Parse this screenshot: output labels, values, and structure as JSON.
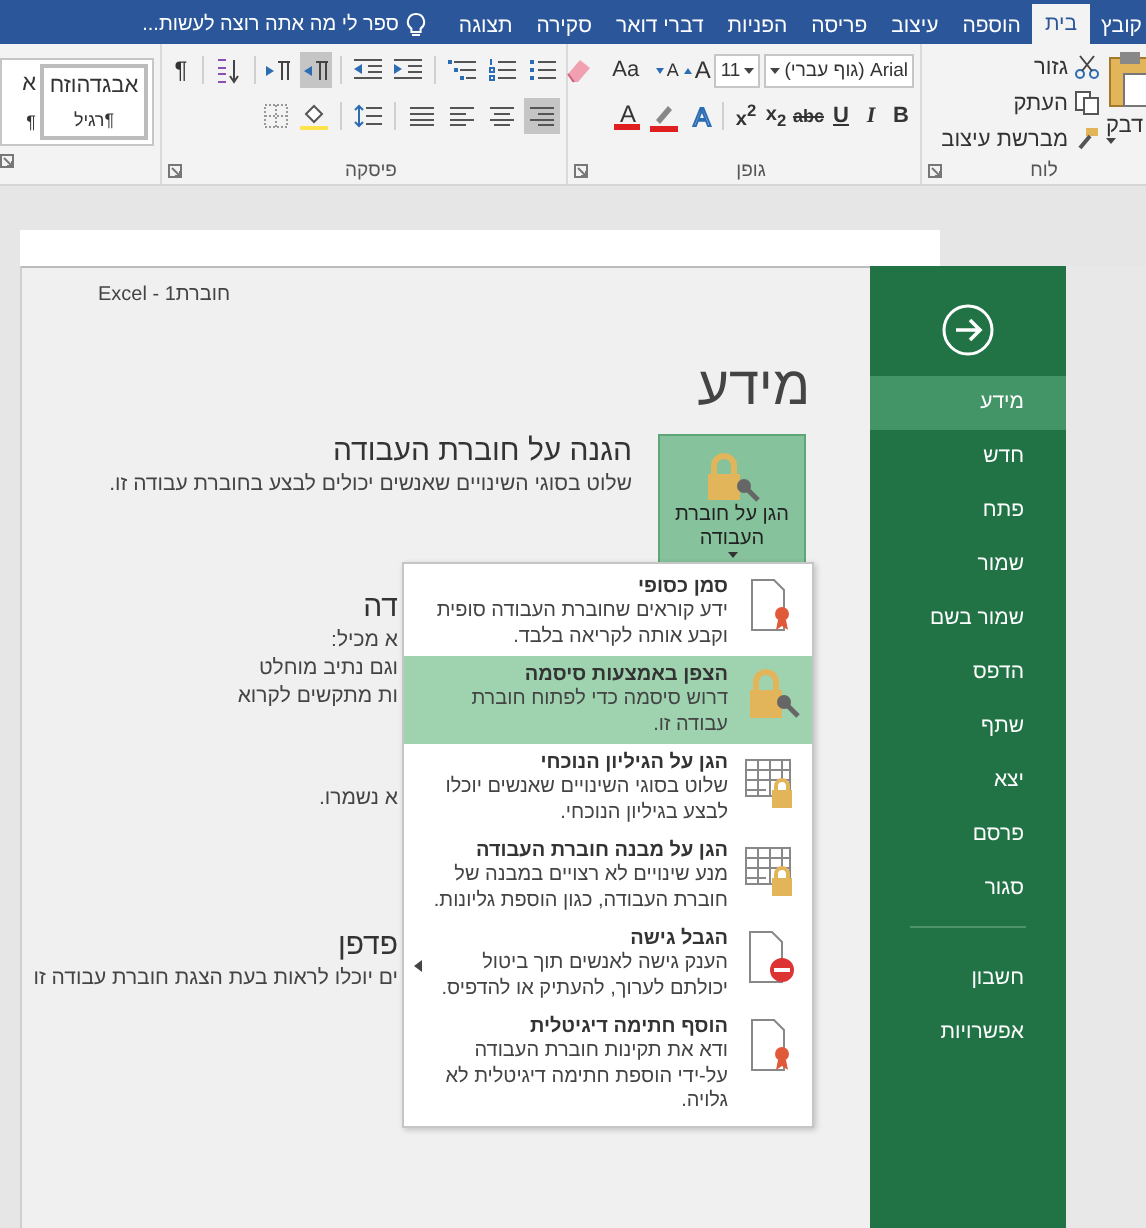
{
  "ribbon_tabs": {
    "tabs": [
      {
        "label": "קובץ",
        "selected": false
      },
      {
        "label": "בית",
        "selected": true
      },
      {
        "label": "הוספה",
        "selected": false
      },
      {
        "label": "עיצוב",
        "selected": false
      },
      {
        "label": "פריסה",
        "selected": false
      },
      {
        "label": "הפניות",
        "selected": false
      },
      {
        "label": "דברי דואר",
        "selected": false
      },
      {
        "label": "סקירה",
        "selected": false
      },
      {
        "label": "תצוגה",
        "selected": false
      }
    ],
    "tell_me": "ספר לי מה אתה רוצה לעשות..."
  },
  "clipboard": {
    "paste": "דבק",
    "cut": "גזור",
    "copy": "העתק",
    "format_painter": "מברשת עיצוב",
    "label": "לוח"
  },
  "font": {
    "name": "Arial (גוף עברי)",
    "size": "11",
    "grow": "A",
    "shrink": "A",
    "change_case": "Aa",
    "bold": "B",
    "italic": "I",
    "underline": "U",
    "strikethrough": "abc",
    "subscript": "x$_{2}$",
    "superscript": "x$^{2}$",
    "text_effects": "A",
    "font_color": "A",
    "label": "גופן"
  },
  "paragraph": {
    "show_marks": "¶",
    "direction_buttons": [
      {
        "selected": true
      },
      {
        "selected": false
      }
    ],
    "alignment_buttons": [
      {
        "selected": true
      },
      {
        "selected": false
      },
      {
        "selected": false
      },
      {
        "selected": false
      }
    ],
    "label": "פיסקה"
  },
  "styles": [
    {
      "sample": "אבגדהוזח",
      "mark": "¶",
      "name": "רגיל"
    },
    {
      "sample": "א",
      "mark": "¶"
    }
  ],
  "backstage": {
    "window_title": "חוברת1 - Excel",
    "heading": "מידע",
    "protect": {
      "button": "הגן על חוברת העבודה",
      "title": "הגנה על חוברת העבודה",
      "description": "שלוט בסוגי השינויים שאנשים יכולים לבצע בחוברת עבודה זו."
    },
    "covered_sections": [
      {
        "title": "דה",
        "lines": [
          "א מכיל:",
          "וגם נתיב מוחלט",
          "ות מתקשים לקרוא"
        ]
      },
      {
        "lines": [
          "א נשמרו."
        ]
      },
      {
        "title": "פדפן",
        "lines": [
          "ים יוכלו לראות בעת הצגת חוברת עבודה זו"
        ]
      }
    ]
  },
  "protect_menu": [
    {
      "kind": "final",
      "title": "סמן כסופי",
      "description": "ידע קוראים שחוברת העבודה סופית וקבע אותה לקריאה בלבד.",
      "selected": false,
      "submenu": false
    },
    {
      "kind": "encrypt",
      "title": "הצפן באמצעות סיסמה",
      "description": "דרוש סיסמה כדי לפתוח חוברת עבודה זו.",
      "selected": true,
      "submenu": false
    },
    {
      "kind": "sheet",
      "title": "הגן על הגיליון הנוכחי",
      "description": "שלוט בסוגי השינויים שאנשים יוכלו לבצע בגיליון הנוכחי.",
      "selected": false,
      "submenu": false
    },
    {
      "kind": "structure",
      "title": "הגן על מבנה חוברת העבודה",
      "description": "מנע שינויים לא רצויים במבנה של חוברת העבודה, כגון הוספת גליונות.",
      "selected": false,
      "submenu": false
    },
    {
      "kind": "restrict",
      "title": "הגבל גישה",
      "description": "הענק גישה לאנשים תוך ביטול יכולתם לערוך, להעתיק או להדפיס.",
      "selected": false,
      "submenu": true
    },
    {
      "kind": "signature",
      "title": "הוסף חתימה דיגיטלית",
      "description": "ודא את תקינות חוברת העבודה על-ידי הוספת חתימה דיגיטלית לא גלויה.",
      "selected": false,
      "submenu": false
    }
  ],
  "sidebar": {
    "items": [
      {
        "label": "מידע",
        "selected": true
      },
      {
        "label": "חדש",
        "selected": false
      },
      {
        "label": "פתח",
        "selected": false
      },
      {
        "label": "שמור",
        "selected": false
      },
      {
        "label": "שמור בשם",
        "selected": false
      },
      {
        "label": "הדפס",
        "selected": false
      },
      {
        "label": "שתף",
        "selected": false
      },
      {
        "label": "יצא",
        "selected": false
      },
      {
        "label": "פרסם",
        "selected": false
      },
      {
        "label": "סגור",
        "selected": false
      }
    ],
    "account_items": [
      {
        "label": "חשבון",
        "selected": false
      },
      {
        "label": "אפשרויות",
        "selected": false
      }
    ]
  }
}
